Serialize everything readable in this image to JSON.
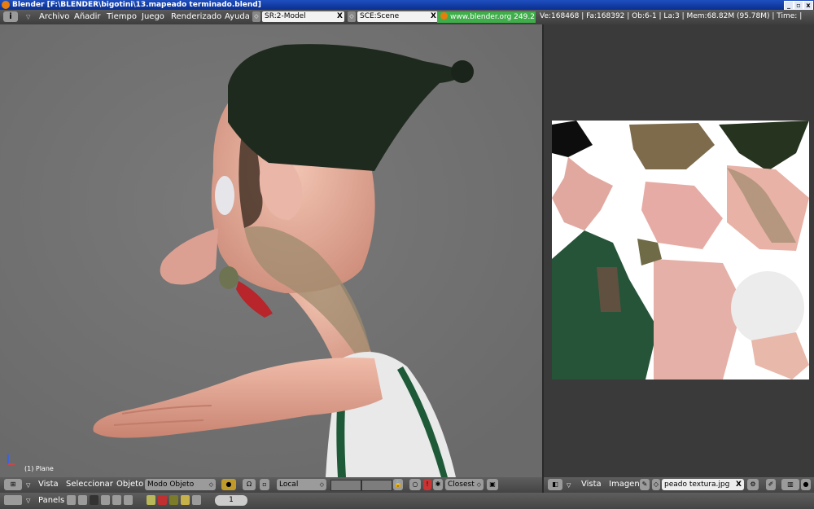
{
  "window": {
    "title": "Blender [F:\\BLENDER\\bigotini\\13.mapeado terminado.blend]",
    "min_symbol": "_",
    "max_symbol": "▫",
    "close_symbol": "x"
  },
  "info_header": {
    "icon_label": "i",
    "menus": [
      "Archivo",
      "Añadir",
      "Tiempo",
      "Juego",
      "Renderizado",
      "Ayuda"
    ],
    "screen_field": "SR:2-Model",
    "scene_field": "SCE:Scene",
    "close_symbol": "X",
    "url": "www.blender.org 249.2",
    "stats": "Ve:168468 | Fa:168392 | Ob:6-1 | La:3 | Mem:68.82M (95.78M) | Time: |"
  },
  "viewport": {
    "object_label": "(1) Plane"
  },
  "view3d_header": {
    "menus": [
      "Vista",
      "Seleccionar",
      "Objeto"
    ],
    "mode": "Modo Objeto",
    "orientation": "Local",
    "snap": "Closest"
  },
  "image_header": {
    "menus": [
      "Vista",
      "Imagen"
    ],
    "image_name": "peado textura.jpg",
    "close_symbol": "X"
  },
  "buttons_header": {
    "label": "Panels",
    "frame": "1"
  },
  "colors": {
    "accent_url": "#3fae4a",
    "titlebar": "#0a2f8f",
    "skin": "#e8b2a0",
    "hat": "#1f2a1f",
    "stripe": "#1e5a38"
  }
}
